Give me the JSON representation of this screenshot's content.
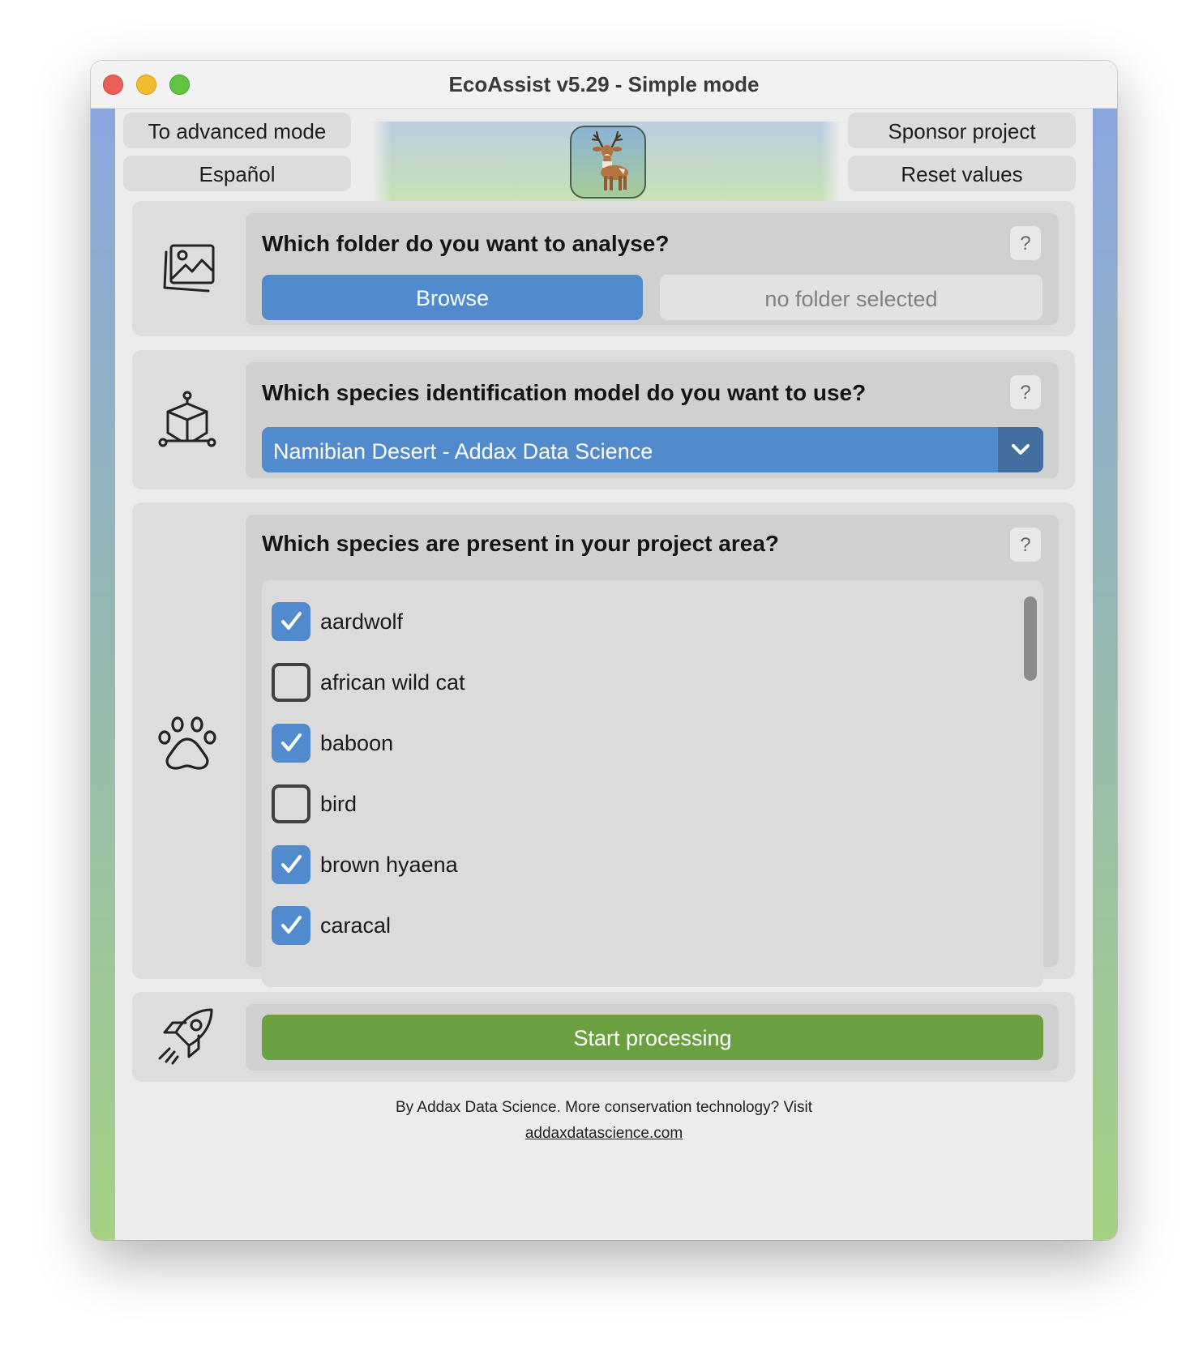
{
  "window": {
    "title": "EcoAssist v5.29 - Simple mode"
  },
  "header": {
    "advanced_mode_label": "To advanced mode",
    "language_label": "Español",
    "sponsor_label": "Sponsor project",
    "reset_label": "Reset values",
    "logo_icon": "deer-icon"
  },
  "folder_section": {
    "icon": "images-icon",
    "question": "Which folder do you want to analyse?",
    "help_label": "?",
    "browse_label": "Browse",
    "folder_value": "no folder selected"
  },
  "model_section": {
    "icon": "model-cube-icon",
    "question": "Which species identification model do you want to use?",
    "help_label": "?",
    "selected_model": "Namibian Desert - Addax Data Science"
  },
  "species_section": {
    "icon": "paw-icon",
    "question": "Which species are present in your project area?",
    "help_label": "?",
    "species": [
      {
        "label": "aardwolf",
        "checked": true
      },
      {
        "label": "african wild cat",
        "checked": false
      },
      {
        "label": "baboon",
        "checked": true
      },
      {
        "label": "bird",
        "checked": false
      },
      {
        "label": "brown hyaena",
        "checked": true
      },
      {
        "label": "caracal",
        "checked": true
      }
    ]
  },
  "start_section": {
    "icon": "rocket-icon",
    "start_label": "Start processing"
  },
  "footer": {
    "text": "By Addax Data Science. More conservation technology? Visit",
    "link": "addaxdatascience.com"
  },
  "colors": {
    "primary_blue": "#528bcd",
    "start_green": "#6ba040",
    "close": "#ec5f57",
    "minimize": "#f3bb2f",
    "maximize": "#5fc442"
  }
}
